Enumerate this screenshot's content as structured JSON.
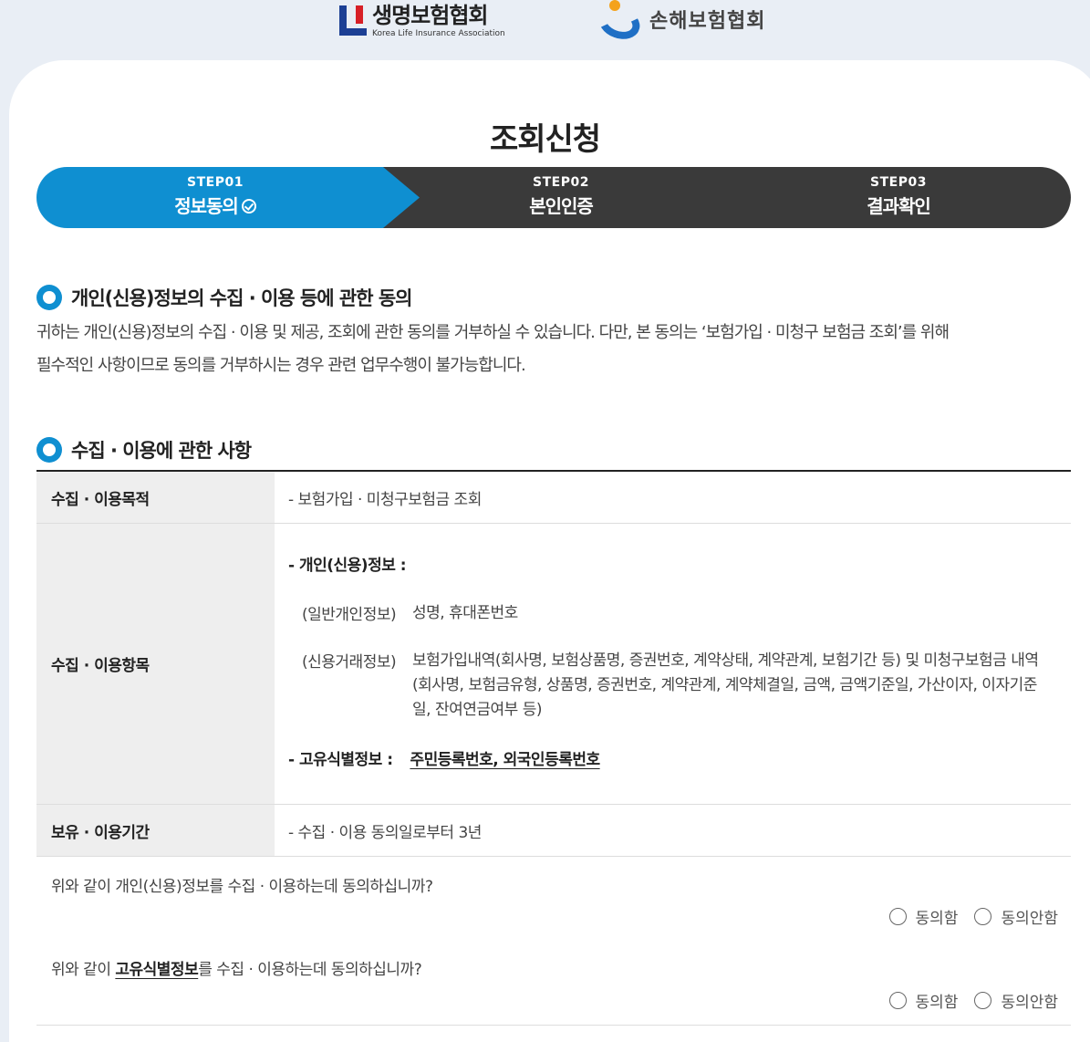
{
  "logos": {
    "klia_name": "생명보험협회",
    "klia_sub": "Korea Life Insurance Association",
    "gia_name": "손해보험협회"
  },
  "page_title": "조회신청",
  "steps": [
    {
      "num": "STEP01",
      "label": "정보동의",
      "active": true
    },
    {
      "num": "STEP02",
      "label": "본인인증",
      "active": false
    },
    {
      "num": "STEP03",
      "label": "결과확인",
      "active": false
    }
  ],
  "colors": {
    "active": "#0f8fd1",
    "inactive": "#3a3a3a",
    "accent": "#0f8fd1"
  },
  "section1": {
    "title": "개인(신용)정보의 수집 · 이용 등에 관한 동의",
    "desc_line1": "귀하는 개인(신용)정보의 수집 · 이용 및 제공, 조회에 관한 동의를 거부하실 수 있습니다. 다만, 본 동의는 ‘보험가입 · 미청구 보험금 조회’를 위해",
    "desc_line2": "필수적인 사항이므로 동의를 거부하시는 경우 관련 업무수행이 불가능합니다."
  },
  "section2": {
    "title": "수집 · 이용에 관한 사항",
    "rows": {
      "purpose_label": "수집 · 이용목적",
      "purpose_value": "- 보험가입 · 미청구보험금 조회",
      "items_label": "수집 · 이용항목",
      "items_personal": "- 개인(신용)정보 :",
      "items_general_tag": "(일반개인정보)",
      "items_general_val": "성명, 휴대폰번호",
      "items_credit_tag": "(신용거래정보)",
      "items_credit_val": "보험가입내역(회사명, 보험상품명, 증권번호, 계약상태, 계약관계, 보험기간 등) 및 미청구보험금 내역(회사명, 보험금유형, 상품명, 증권번호, 계약관계, 계약체결일, 금액, 금액기준일, 가산이자, 이자기준일, 잔여연금여부 등)",
      "items_unique_label": "- 고유식별정보 :",
      "items_unique_val": "주민등록번호, 외국인등록번호",
      "period_label": "보유 · 이용기간",
      "period_value": "- 수집 · 이용 동의일로부터 3년"
    }
  },
  "questions": {
    "q1": "위와 같이 개인(신용)정보를 수집 · 이용하는데 동의하십니까?",
    "q2_prefix": "위와 같이 ",
    "q2_bold": "고유식별정보",
    "q2_suffix": "를 수집 · 이용하는데 동의하십니까?",
    "agree": "동의함",
    "disagree": "동의안함"
  }
}
